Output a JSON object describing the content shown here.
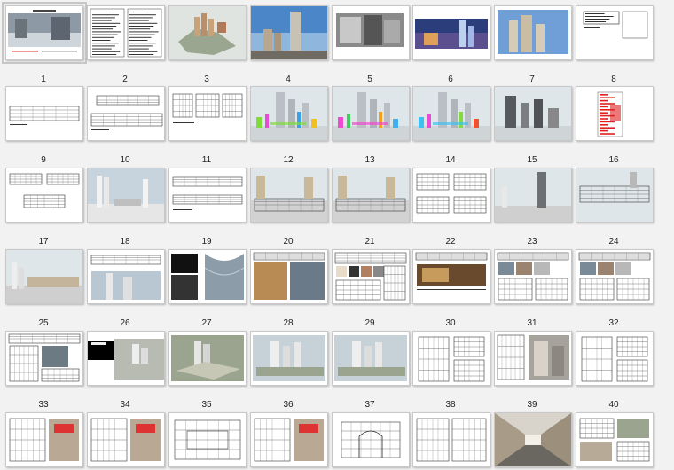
{
  "view": "slide-sorter",
  "selected_slide": 1,
  "slides": [
    {
      "number": "1",
      "kind": "cover"
    },
    {
      "number": "2",
      "kind": "table"
    },
    {
      "number": "3",
      "kind": "aerial"
    },
    {
      "number": "4",
      "kind": "towers-sky"
    },
    {
      "number": "5",
      "kind": "bw-photo"
    },
    {
      "number": "6",
      "kind": "night-render"
    },
    {
      "number": "7",
      "kind": "towers-sky2"
    },
    {
      "number": "8",
      "kind": "elev-text"
    },
    {
      "number": "9",
      "kind": "elevation"
    },
    {
      "number": "10",
      "kind": "elev-long"
    },
    {
      "number": "11",
      "kind": "elev-multi"
    },
    {
      "number": "12",
      "kind": "color-diagram"
    },
    {
      "number": "13",
      "kind": "color-diagram2"
    },
    {
      "number": "14",
      "kind": "color-diagram3"
    },
    {
      "number": "15",
      "kind": "massing"
    },
    {
      "number": "16",
      "kind": "red-section"
    },
    {
      "number": "17",
      "kind": "elev-three"
    },
    {
      "number": "18",
      "kind": "model-white"
    },
    {
      "number": "19",
      "kind": "elev-long2"
    },
    {
      "number": "20",
      "kind": "model-long"
    },
    {
      "number": "21",
      "kind": "model-long2"
    },
    {
      "number": "22",
      "kind": "elev-quad"
    },
    {
      "number": "23",
      "kind": "tower-model"
    },
    {
      "number": "24",
      "kind": "street-model"
    },
    {
      "number": "25",
      "kind": "model-street2"
    },
    {
      "number": "26",
      "kind": "elev-wide"
    },
    {
      "number": "27",
      "kind": "dark-glass"
    },
    {
      "number": "28",
      "kind": "board-photos"
    },
    {
      "number": "29",
      "kind": "board-materials"
    },
    {
      "number": "30",
      "kind": "board-lobby"
    },
    {
      "number": "31",
      "kind": "board-details"
    },
    {
      "number": "32",
      "kind": "board-details2"
    },
    {
      "number": "33",
      "kind": "board-grid"
    },
    {
      "number": "34",
      "kind": "dark-model"
    },
    {
      "number": "35",
      "kind": "aerial-model"
    },
    {
      "number": "36",
      "kind": "massing-model"
    },
    {
      "number": "37",
      "kind": "massing-model2"
    },
    {
      "number": "38",
      "kind": "cad-facade"
    },
    {
      "number": "39",
      "kind": "render-street"
    },
    {
      "number": "40",
      "kind": "cad-facade2"
    },
    {
      "number": "",
      "kind": "cad-photo"
    },
    {
      "number": "",
      "kind": "cad-photo2"
    },
    {
      "number": "",
      "kind": "cad-plan"
    },
    {
      "number": "",
      "kind": "cad-photo3"
    },
    {
      "number": "",
      "kind": "cad-arch"
    },
    {
      "number": "",
      "kind": "cad-section"
    },
    {
      "number": "",
      "kind": "corridor"
    },
    {
      "number": "",
      "kind": "cad-mixed"
    }
  ],
  "colors": {
    "background": "#f2f2f2",
    "slide_border": "#c8c8c8",
    "sky": "#c9d4dc",
    "brick": "#b45a3c",
    "highlight_red": "#e02020"
  }
}
